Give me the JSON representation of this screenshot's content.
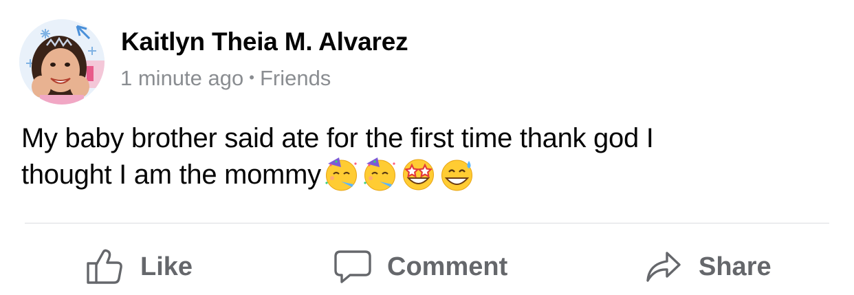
{
  "post": {
    "author": "Kaitlyn Theia M. Alvarez",
    "timestamp": "1 minute ago",
    "separator": "•",
    "audience": "Friends",
    "text_line1": "My baby brother said ate for the first time thank god I",
    "text_line2": "thought I am the mommy",
    "emojis": [
      "partying-face",
      "partying-face",
      "star-struck",
      "grinning-face-with-sweat"
    ]
  },
  "actions": {
    "like_label": "Like",
    "comment_label": "Comment",
    "share_label": "Share"
  },
  "colors": {
    "text": "#050505",
    "secondary_text": "#65676b",
    "meta_text": "#8a8d91",
    "divider": "#dadde1",
    "emoji_face": "#ffcc33"
  }
}
